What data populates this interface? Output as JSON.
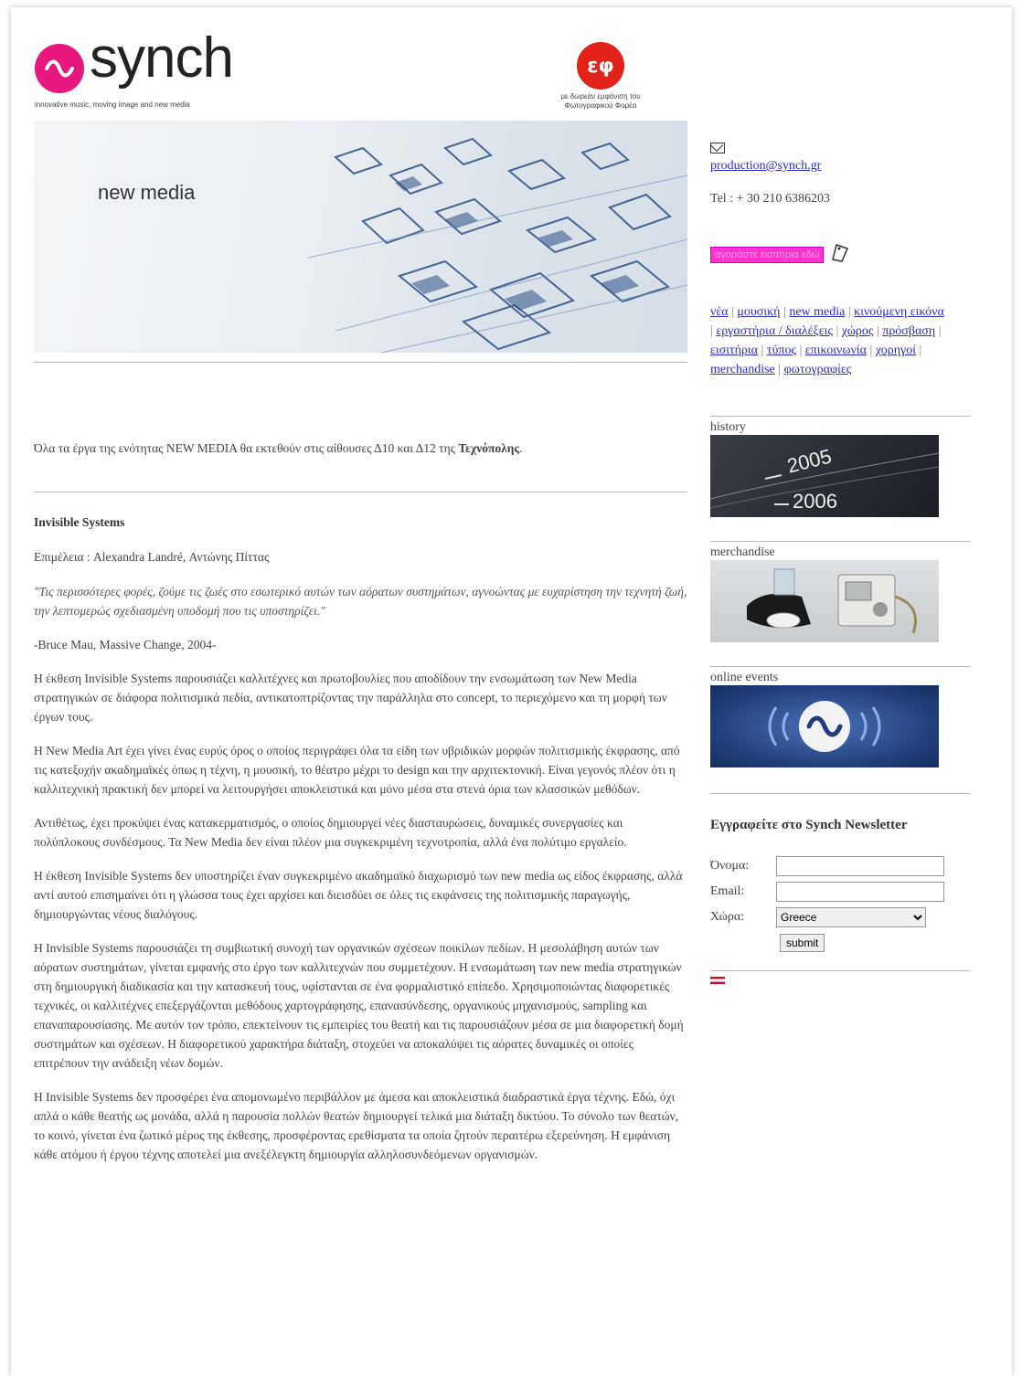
{
  "header": {
    "brand_name": "synch",
    "brand_tagline": "innovative music, moving image and new media",
    "sponsor_text": "με δωρεάν εμφάνιση του Φωτογραφικού Φορέα"
  },
  "banner": {
    "label": "new media"
  },
  "sidebar": {
    "email": "production@synch.gr",
    "phone": "Tel : + 30 210 6386203",
    "cta": "αγοράστε εισιτήρια εδώ",
    "nav_items": [
      "νέα",
      "μουσική",
      "new media",
      "κινούμενη εικόνα",
      "εργαστήρια / διαλέξεις",
      "χώρος",
      "πρόσβαση",
      "εισιτήρια",
      "τύπος",
      "επικοινωνία",
      "χορηγοί",
      "merchandise",
      "φωτογραφίες"
    ],
    "history_label": "history",
    "history_years": [
      "2005",
      "2006"
    ],
    "merchandise_label": "merchandise",
    "online_events_label": "online events"
  },
  "newsletter": {
    "title": "Εγγραφείτε στο Synch Newsletter",
    "name_label": "Όνομα:",
    "email_label": "Email:",
    "country_label": "Χώρα:",
    "country_value": "Greece",
    "submit_label": "submit"
  },
  "content": {
    "intro_prefix": "Όλα τα έργα της ενότητας NEW MEDIA θα εκτεθούν στις αίθουσες Δ10 και Δ12 της",
    "intro_bold": "Τεχνόπολης",
    "heading": "Invisible Systems",
    "curators": "Επιμέλεια : Alexandra Landré, Αντώνης Πίττας",
    "quote": "\"Τις περισσότερες φορές, ζούμε τις ζωές στο εσωτερικό αυτών των αόρατων συστημάτων, αγνοώντας με ευχαρίστηση την τεχνητή ζωή, την λεπτομερώς σχεδιασμένη υποδομή που τις υποστηρίζει.\"",
    "attribution": "-Bruce Mau, Massive Change, 2004-",
    "p1": "Η έκθεση Invisible Systems παρουσιάζει καλλιτέχνες και πρωτοβουλίες που αποδίδουν την ενσωμάτωση των New Media στρατηγικών σε διάφορα πολιτισμικά πεδία, αντικατοπτρίζοντας την παράλληλα στο concept, το περιεχόμενο και τη μορφή των έργων τους.",
    "p2": "Η New Media Art έχει γίνει ένας ευρύς όρος ο οποίος περιγράφει όλα τα είδη των υβριδικών μορφών πολιτισμικής έκφρασης, από τις κατεξοχήν ακαδημαϊκές όπως η τέχνη, η μουσική, το θέατρο μέχρι το design και την αρχιτεκτονική. Είναι γεγονός πλέον ότι η καλλιτεχνική πρακτική δεν μπορεί να λειτουργήσει αποκλειστικά και μόνο μέσα στα στενά όρια των κλασσικών μεθόδων.",
    "p3": "Αντιθέτως, έχει προκύψει ένας κατακερματισμός, ο οποίος δημιουργεί νέες διασταυρώσεις, δυναμικές συνεργασίες και πολύπλοκους συνδέσμους. Τα New Media δεν είναι πλέον μια συγκεκριμένη τεχνοτροπία, αλλά ένα πολύτιμο εργαλείο.",
    "p4": "Η έκθεση Invisible Systems δεν υποστηρίζει έναν συγκεκριμένο ακαδημαϊκό διαχωρισμό των new media ως είδος έκφρασης, αλλά αντί αυτού επισημαίνει ότι η γλώσσα τους έχει αρχίσει και διεισδύει σε όλες τις εκφάνσεις της πολιτισμικής παραγωγής, δημιουργώντας νέους διαλόγους.",
    "p5": "Η Invisible Systems παρουσιάζει τη συμβιωτική συνοχή των οργανικών σχέσεων ποικίλων πεδίων. Η μεσολάβηση αυτών των αόρατων συστημάτων, γίνεται εμφανής στο έργο των καλλιτεχνών που συμμετέχουν. Η ενσωμάτωση των new media στρατηγικών στη δημιουργική διαδικασία και την κατασκευή τους, υφίστανται σε ένα φορμαλιστικό επίπεδο. Χρησιμοποιώντας διαφορετικές τεχνικές, οι καλλιτέχνες επεξεργάζονται μεθόδους χαρτογράφησης, επανασύνδεσης, οργανικούς μηχανισμούς, sampling και επαναπαρουσίασης. Με αυτόν τον τρόπο, επεκτείνουν τις εμπειρίες του θεατή και τις παρουσιάζουν μέσα σε μια διαφορετική δομή συστημάτων και σχέσεων. Η διαφορετικού χαρακτήρα διάταξη, στοχεύει να αποκαλύψει τις αόρατες δυναμικές οι οποίες επιτρέπουν την ανάδειξη νέων δομών.",
    "p6": "Η Invisible Systems δεν προσφέρει ένα απομονωμένο περιβάλλον με άμεσα και αποκλειστικά διαδραστικά έργα τέχνης. Εδώ, όχι απλά ο κάθε θεατής ως μονάδα, αλλά η παρουσία πολλών θεατών δημιουργεί τελικά μια διάταξη δικτύου. Το σύνολο των θεατών, το κοινό, γίνεται ένα ζωτικό μέρος της έκθεσης, προσφέροντας ερεθίσματα τα οποία ζητούν περαιτέρω εξερεύνηση. Η εμφάνιση κάθε ατόμου ή έργου τέχνης αποτελεί μια ανεξέλεγκτη δημιουργία αλληλοσυνδεόμενων οργανισμών."
  },
  "colors": {
    "accent_pink": "#e6177d",
    "link_blue": "#2b2bd0",
    "sponsor_red": "#e2231a",
    "cta_magenta": "#ff33cc"
  }
}
